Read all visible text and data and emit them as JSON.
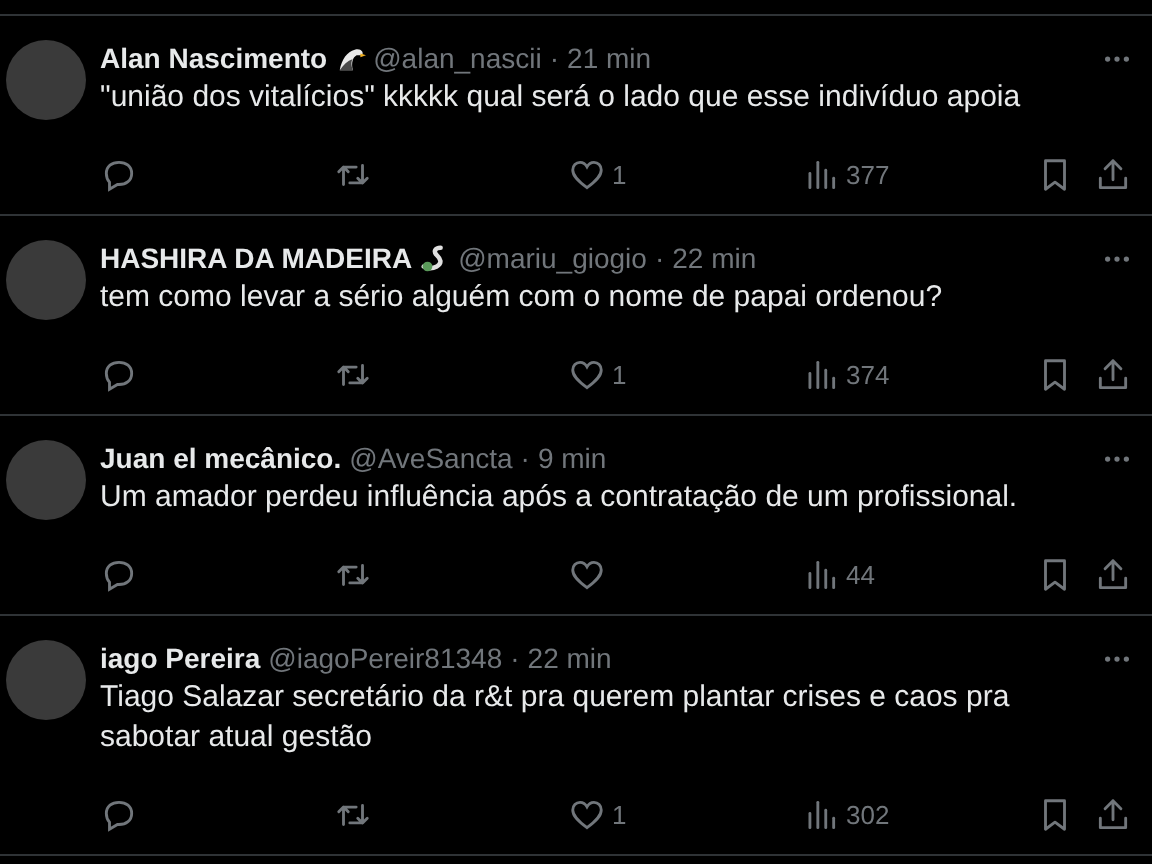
{
  "posts": [
    {
      "name": "Alan Nascimento",
      "kind": "eagle",
      "handle": "@alan_nascii",
      "separator": "·",
      "time": "21 min",
      "text": "\"união dos vitalícios\" kkkkk qual será o lado que esse indivíduo apoia",
      "likes": "1",
      "views": "377"
    },
    {
      "name": "HASHIRA DA MADEIRA",
      "kind": "snake",
      "handle": "@mariu_giogio",
      "separator": "·",
      "time": "22 min",
      "text": "tem como levar a sério alguém com o nome de papai ordenou?",
      "likes": "1",
      "views": "374"
    },
    {
      "name": "Juan el mecânico.",
      "kind": "plain",
      "handle": "@AveSancta",
      "separator": "·",
      "time": "9 min",
      "text": "Um amador perdeu influência após a contratação de um profissional.",
      "views": "44"
    },
    {
      "name": "iago Pereira",
      "kind": "plain",
      "handle": "@iagoPereir81348",
      "separator": "·",
      "time": "22 min",
      "text": "Tiago Salazar secretário da r&t pra querem plantar crises e caos pra sabotar atual gestão",
      "likes": "1",
      "views": "302"
    }
  ]
}
